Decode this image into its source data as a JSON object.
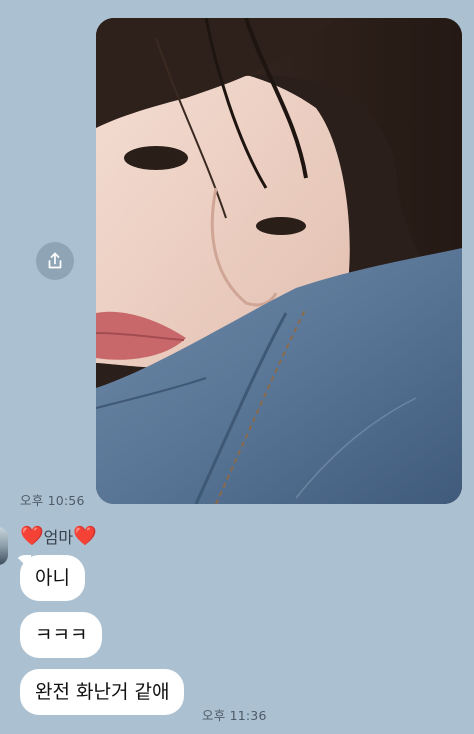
{
  "photo_message": {
    "timestamp": "오후 10:56",
    "share_icon": "share-upload-icon",
    "image_subject": "close-up selfie of a girl resting her face on a denim jacket"
  },
  "incoming": {
    "sender_prefix": "❤️",
    "sender_name": "엄마",
    "sender_suffix": "❤️",
    "messages": [
      {
        "text": "아니"
      },
      {
        "text": "ㅋㅋㅋ"
      },
      {
        "text": "완전 화난거 같애"
      }
    ],
    "timestamp": "오후 11:36"
  },
  "colors": {
    "background": "#abc1d1",
    "bubble": "#ffffff",
    "heart": "#e02a2a"
  }
}
